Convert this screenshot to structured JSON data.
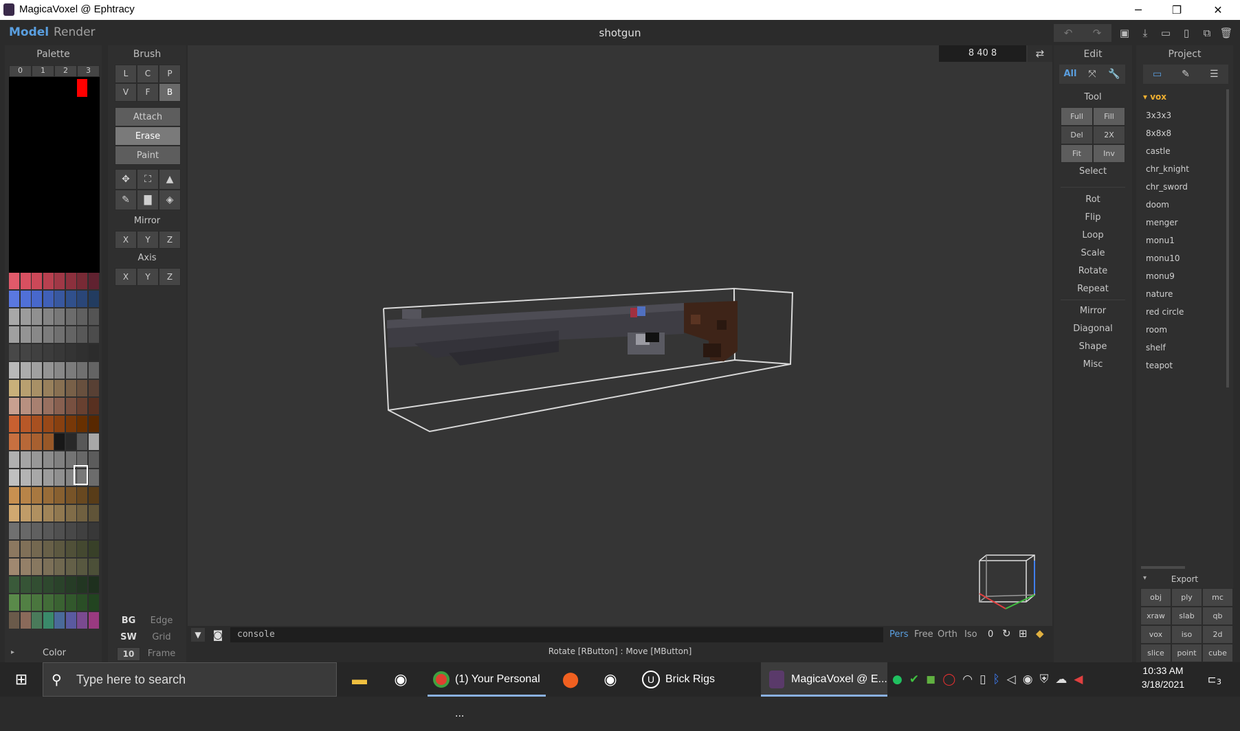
{
  "window": {
    "title": "MagicaVoxel @ Ephtracy",
    "minimize": "─",
    "restore": "❐",
    "close": "✕"
  },
  "menubar": {
    "tab_model": "Model",
    "tab_render": "Render",
    "doc_title": "shotgun"
  },
  "palette": {
    "header": "Palette",
    "pages": [
      "0",
      "1",
      "2",
      "3"
    ],
    "footer_label": "Color",
    "rows": [
      [
        "#e05a6a",
        "#d85060",
        "#cc4858",
        "#b8404f",
        "#a03846",
        "#8c303d",
        "#782a35",
        "#602230"
      ],
      [
        "#5a78e0",
        "#5070d8",
        "#4868cc",
        "#4060b8",
        "#3858a0",
        "#30508c",
        "#2a4678",
        "#223c60"
      ],
      [
        "#a8a8a8",
        "#9c9c9c",
        "#909090",
        "#848484",
        "#787878",
        "#6c6c6c",
        "#606060",
        "#545454"
      ],
      [
        "#a0a0a0",
        "#949494",
        "#888888",
        "#7c7c7c",
        "#707070",
        "#646464",
        "#585858",
        "#4c4c4c"
      ],
      [
        "#484848",
        "#444444",
        "#404040",
        "#3c3c3c",
        "#383838",
        "#343434",
        "#303030",
        "#2c2c2c"
      ],
      [
        "#b8b8b8",
        "#acacac",
        "#a0a0a0",
        "#949494",
        "#888888",
        "#7c7c7c",
        "#707070",
        "#646464"
      ],
      [
        "#c8b07a",
        "#b8a070",
        "#a89066",
        "#98805c",
        "#887052",
        "#786048",
        "#68503e",
        "#584034"
      ],
      [
        "#c8a090",
        "#b89080",
        "#a88070",
        "#987060",
        "#886050",
        "#785040",
        "#684030",
        "#583020"
      ],
      [
        "#c86030",
        "#b85828",
        "#a85020",
        "#984818",
        "#884010",
        "#783808",
        "#683000",
        "#582800"
      ],
      [
        "#c87040",
        "#b86838",
        "#a86030",
        "#985828",
        "#181818",
        "#282828",
        "#585858",
        "#a8a8a8"
      ],
      [
        "#b0b0b0",
        "#a4a4a4",
        "#989898",
        "#8c8c8c",
        "#808080",
        "#747474",
        "#686868",
        "#5c5c5c"
      ],
      [
        "#c0c0c0",
        "#b4b4b4",
        "#a8a8a8",
        "#9c9c9c",
        "#909090",
        "#848484",
        "#787878",
        "#6c6c6c"
      ],
      [
        "#c89050",
        "#b88448",
        "#a87840",
        "#986c38",
        "#886030",
        "#785428",
        "#684820",
        "#583c18"
      ],
      [
        "#d0a870",
        "#c09c68",
        "#b09060",
        "#a08458",
        "#907850",
        "#806c48",
        "#706040",
        "#605438"
      ],
      [
        "#707070",
        "#686868",
        "#606060",
        "#585858",
        "#505050",
        "#484848",
        "#404040",
        "#383838"
      ],
      [
        "#8c7860",
        "#807058",
        "#746850",
        "#686048",
        "#5c5840",
        "#505038",
        "#444830",
        "#384028"
      ],
      [
        "#a08870",
        "#948068",
        "#887860",
        "#7c7058",
        "#706850",
        "#646048",
        "#585840",
        "#4c5038"
      ],
      [
        "#3a5a3a",
        "#365436",
        "#324e32",
        "#2e482e",
        "#2a422a",
        "#263c26",
        "#223622",
        "#1e301e"
      ],
      [
        "#5a8a4a",
        "#528044",
        "#4a763e",
        "#426c38",
        "#3a6232",
        "#32582c",
        "#2a4e26",
        "#224420"
      ],
      [
        "#6a5a4a",
        "#8a6a5a",
        "#4a7a5a",
        "#3a8a6a",
        "#4a6a9a",
        "#5a5aa0",
        "#7a4a90",
        "#9a3a80"
      ]
    ]
  },
  "brush": {
    "header": "Brush",
    "modes_row1": [
      "L",
      "C",
      "P"
    ],
    "modes_row2": [
      "V",
      "F",
      "B"
    ],
    "actions": [
      "Attach",
      "Erase",
      "Paint"
    ],
    "mirror_label": "Mirror",
    "mirror_axes": [
      "X",
      "Y",
      "Z"
    ],
    "axis_label": "Axis",
    "axis_axes": [
      "X",
      "Y",
      "Z"
    ],
    "bottom": [
      {
        "key": "BG",
        "value": "Edge"
      },
      {
        "key": "SW",
        "value": "Grid"
      },
      {
        "key": "10",
        "value": "Frame"
      }
    ]
  },
  "viewport": {
    "dimensions": "8  40  8",
    "console_placeholder": "console",
    "view_modes": [
      "Pers",
      "Free",
      "Orth",
      "Iso"
    ],
    "view_value": "0",
    "status": "Rotate [RButton] : Move [MButton]",
    "colors": {
      "accent": "#5a9fe0"
    }
  },
  "edit": {
    "header": "Edit",
    "filter": "All",
    "tool_label": "Tool",
    "tool_buttons": [
      [
        "Full",
        "Fill"
      ],
      [
        "Del",
        "2X"
      ],
      [
        "Fit",
        "Inv"
      ]
    ],
    "select_label": "Select",
    "group1": [
      "Rot",
      "Flip",
      "Loop",
      "Scale",
      "Rotate",
      "Repeat"
    ],
    "group2": [
      "Mirror",
      "Diagonal",
      "Shape",
      "Misc"
    ]
  },
  "project": {
    "header": "Project",
    "folder": "▾ vox",
    "items": [
      "3x3x3",
      "8x8x8",
      "castle",
      "chr_knight",
      "chr_sword",
      "doom",
      "menger",
      "monu1",
      "monu10",
      "monu9",
      "nature",
      "red circle",
      "room",
      "shelf",
      "teapot"
    ],
    "export_label": "Export",
    "export_buttons": [
      [
        "obj",
        "ply",
        "mc"
      ],
      [
        "xraw",
        "slab",
        "qb"
      ],
      [
        "vox",
        "iso",
        "2d"
      ],
      [
        "slice",
        "point",
        "cube"
      ]
    ]
  },
  "taskbar": {
    "search_placeholder": "Type here to search",
    "apps": [
      "(1) Your Personal ...",
      "Brick Rigs",
      "MagicaVoxel @ E..."
    ],
    "time": "10:33 AM",
    "date": "3/18/2021",
    "notifications": "3"
  }
}
